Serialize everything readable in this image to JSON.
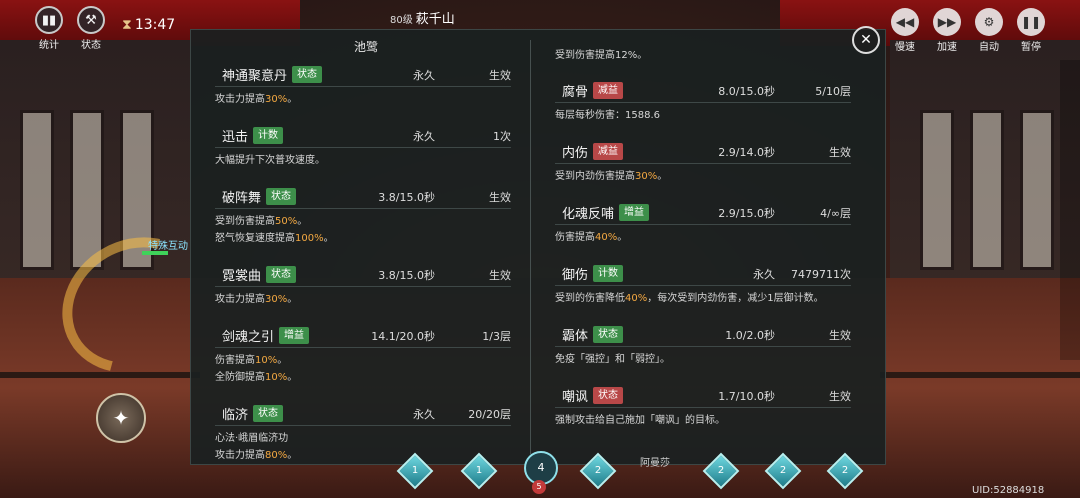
{
  "hud": {
    "stats_label": "统计",
    "status_label": "状态",
    "timer": "13:47",
    "boss_level": "80级",
    "boss_name": "萩千山"
  },
  "controls": {
    "slow_label": "慢速",
    "fast_label": "加速",
    "auto_label": "自动",
    "pause_label": "暂停"
  },
  "hero_label": "特殊互动",
  "panel": {
    "title": "池鹭"
  },
  "top_line": "受到伤害提高12%。",
  "left_buffs": [
    {
      "name": "神通聚意丹",
      "tag": "状态",
      "tag_color": "#3d8f4a",
      "duration": "永久",
      "stack": "生效",
      "desc": [
        [
          "攻击力提高",
          "30%",
          "。"
        ]
      ]
    },
    {
      "name": "迅击",
      "tag": "计数",
      "tag_color": "#3d8f4a",
      "duration": "永久",
      "stack": "1次",
      "desc": [
        [
          "大幅提升下次普攻速度。",
          "",
          ""
        ]
      ]
    },
    {
      "name": "破阵舞",
      "tag": "状态",
      "tag_color": "#3d8f4a",
      "duration": "3.8/15.0秒",
      "stack": "生效",
      "desc": [
        [
          "受到伤害提高",
          "50%",
          "。"
        ],
        [
          "怒气恢复速度提高",
          "100%",
          "。"
        ]
      ]
    },
    {
      "name": "霓裳曲",
      "tag": "状态",
      "tag_color": "#3d8f4a",
      "duration": "3.8/15.0秒",
      "stack": "生效",
      "desc": [
        [
          "攻击力提高",
          "30%",
          "。"
        ]
      ]
    },
    {
      "name": "剑魂之引",
      "tag": "增益",
      "tag_color": "#3d8f4a",
      "duration": "14.1/20.0秒",
      "stack": "1/3层",
      "desc": [
        [
          "伤害提高",
          "10%",
          "。"
        ],
        [
          "全防御提高",
          "10%",
          "。"
        ]
      ]
    },
    {
      "name": "临济",
      "tag": "状态",
      "tag_color": "#3d8f4a",
      "duration": "永久",
      "stack": "20/20层",
      "desc": [
        [
          "心法·峨眉临济功",
          "",
          ""
        ],
        [
          "攻击力提高",
          "80%",
          "。"
        ]
      ]
    }
  ],
  "right_buffs": [
    {
      "name": "腐骨",
      "tag": "减益",
      "tag_color": "#b84848",
      "duration": "8.0/15.0秒",
      "stack": "5/10层",
      "desc": [
        [
          "每层每秒伤害：1588.6",
          "",
          ""
        ]
      ]
    },
    {
      "name": "内伤",
      "tag": "减益",
      "tag_color": "#b84848",
      "duration": "2.9/14.0秒",
      "stack": "生效",
      "desc": [
        [
          "受到内劲伤害提高",
          "30%",
          "。"
        ]
      ]
    },
    {
      "name": "化魂反哺",
      "tag": "增益",
      "tag_color": "#3d8f4a",
      "duration": "2.9/15.0秒",
      "stack": "4/∞层",
      "desc": [
        [
          "伤害提高",
          "40%",
          "。"
        ]
      ]
    },
    {
      "name": "御伤",
      "tag": "计数",
      "tag_color": "#3d8f4a",
      "duration": "永久",
      "stack": "7479711次",
      "desc": [
        [
          "受到的伤害降低",
          "40%",
          "，每次受到内劲伤害，减少1层御计数。"
        ]
      ]
    },
    {
      "name": "霸体",
      "tag": "状态",
      "tag_color": "#3d8f4a",
      "duration": "1.0/2.0秒",
      "stack": "生效",
      "desc": [
        [
          "免疫「强控」和「弱控」。",
          "",
          ""
        ]
      ]
    },
    {
      "name": "嘲讽",
      "tag": "状态",
      "tag_color": "#b84848",
      "duration": "1.7/10.0秒",
      "stack": "生效",
      "desc": [
        [
          "强制攻击给自己施加「嘲讽」的目标。",
          "",
          ""
        ]
      ]
    }
  ],
  "bottom": {
    "gems": [
      "1",
      "1",
      "4",
      "2",
      "2",
      "2",
      "2"
    ],
    "center_red": "5",
    "pet_name": "阿曼莎",
    "uid": "UID:52884918"
  }
}
